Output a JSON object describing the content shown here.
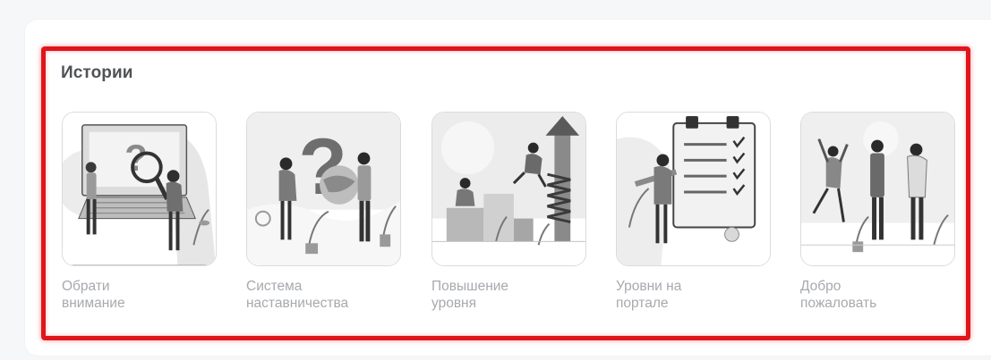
{
  "section": {
    "title": "Истории"
  },
  "stories": [
    {
      "label_line1": "Обрати",
      "label_line2": "внимание",
      "icon": "attention-illustration-icon"
    },
    {
      "label_line1": "Система",
      "label_line2": "наставничества",
      "icon": "mentoring-illustration-icon"
    },
    {
      "label_line1": "Повышение",
      "label_line2": "уровня",
      "icon": "level-up-illustration-icon"
    },
    {
      "label_line1": "Уровни на",
      "label_line2": "портале",
      "icon": "portal-levels-illustration-icon"
    },
    {
      "label_line1": "Добро",
      "label_line2": "пожаловать",
      "icon": "welcome-illustration-icon"
    }
  ],
  "colors": {
    "highlight_border": "#e0151b",
    "title_text": "#505256",
    "label_text": "#a6a9ae",
    "thumb_border": "#d9dbe0"
  }
}
